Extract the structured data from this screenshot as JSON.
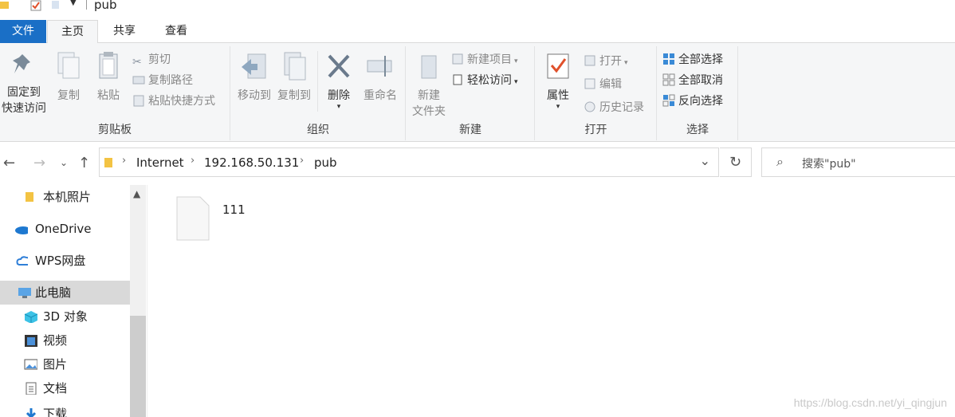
{
  "window": {
    "title": "pub"
  },
  "ribbon_tabs": {
    "file": "文件",
    "home": "主页",
    "share": "共享",
    "view": "查看"
  },
  "clipboard": {
    "pin_line1": "固定到",
    "pin_line2": "快速访问",
    "copy": "复制",
    "paste": "粘贴",
    "cut": "剪切",
    "copy_path": "复制路径",
    "paste_shortcut": "粘贴快捷方式",
    "group_label": "剪贴板"
  },
  "organize": {
    "move_to": "移动到",
    "copy_to": "复制到",
    "delete": "删除",
    "rename": "重命名",
    "group_label": "组织"
  },
  "new_group": {
    "new_folder_line1": "新建",
    "new_folder_line2": "文件夹",
    "new_item": "新建项目",
    "easy_access": "轻松访问",
    "group_label": "新建"
  },
  "open_group": {
    "properties": "属性",
    "open": "打开",
    "edit": "编辑",
    "history": "历史记录",
    "group_label": "打开"
  },
  "select_group": {
    "select_all": "全部选择",
    "select_none": "全部取消",
    "invert": "反向选择",
    "group_label": "选择"
  },
  "address": {
    "crumbs": [
      "Internet",
      "192.168.50.131",
      "pub"
    ]
  },
  "search": {
    "placeholder": "搜索\"pub\""
  },
  "nav": {
    "items": [
      "本机照片",
      "OneDrive",
      "WPS网盘",
      "此电脑",
      "3D 对象",
      "视频",
      "图片",
      "文档",
      "下载"
    ]
  },
  "files": [
    {
      "name": "111"
    }
  ],
  "watermark": "https://blog.csdn.net/yi_qingjun",
  "colors": {
    "file_tab": "#1a6fc6",
    "selected_nav": "#d9d9d9"
  }
}
